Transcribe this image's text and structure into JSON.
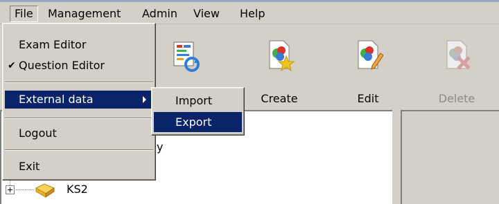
{
  "menubar": {
    "items": [
      "File",
      "Management",
      "Admin",
      "View",
      "Help"
    ],
    "active": "File"
  },
  "file_menu": {
    "items": [
      {
        "label": "Exam Editor",
        "checked": false
      },
      {
        "label": "Question Editor",
        "checked": true
      },
      {
        "label": "External data",
        "submenu": true,
        "highlighted": true
      },
      {
        "label": "Logout"
      },
      {
        "label": "Exit"
      }
    ],
    "check_glyph": "✔"
  },
  "external_data_submenu": {
    "items": [
      {
        "label": "Import",
        "highlighted": false
      },
      {
        "label": "Export",
        "highlighted": true
      }
    ]
  },
  "toolbar": {
    "buttons": [
      {
        "label": "",
        "icon": "refresh-report-icon",
        "enabled": true
      },
      {
        "label": "Create",
        "icon": "create-star-icon",
        "enabled": true
      },
      {
        "label": "Edit",
        "icon": "edit-pencil-icon",
        "enabled": true
      },
      {
        "label": "Delete",
        "icon": "delete-x-icon",
        "enabled": false
      }
    ]
  },
  "tree": {
    "partial_text": "y",
    "nodes": [
      {
        "label": "KS2",
        "icon": "book-icon",
        "expanded": false
      }
    ]
  },
  "colors": {
    "menu_highlight": "#0a246a",
    "face": "#d4d0c8",
    "disabled_text": "#8a8a8a"
  }
}
